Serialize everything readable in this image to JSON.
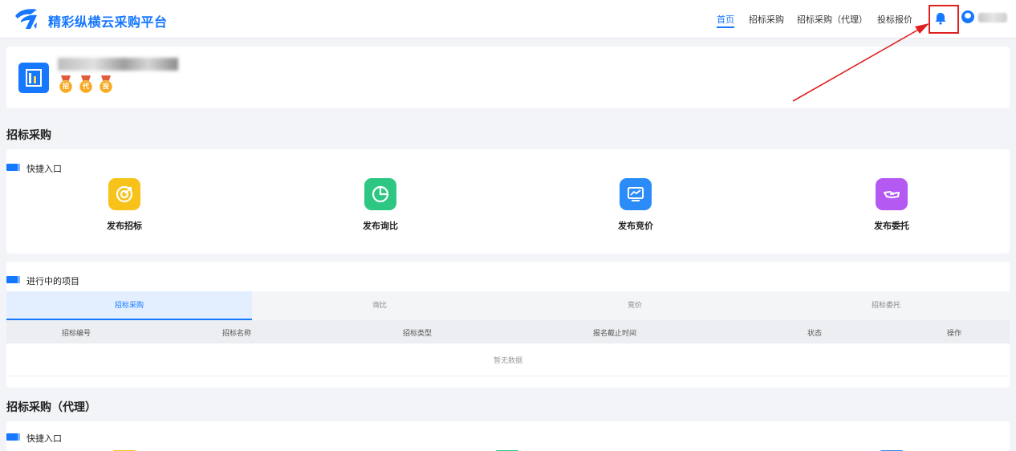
{
  "header": {
    "brand": "精彩纵横云采购平台",
    "nav": [
      {
        "label": "首页",
        "active": true
      },
      {
        "label": "招标采购",
        "active": false
      },
      {
        "label": "招标采购（代理）",
        "active": false
      },
      {
        "label": "投标报价",
        "active": false
      }
    ],
    "icons": [
      "logo-icon",
      "bell-icon",
      "user-avatar-icon"
    ],
    "accent_color": "#1677ff"
  },
  "profile": {
    "medals": [
      "招",
      "代",
      "投"
    ]
  },
  "section_bidding": {
    "title": "招标采购",
    "quick_entry_title": "快捷入口",
    "quick_items": [
      {
        "label": "发布招标",
        "icon": "target-icon",
        "color": "#f7c31b"
      },
      {
        "label": "发布询比",
        "icon": "pie-chart-icon",
        "color": "#2ec683"
      },
      {
        "label": "发布竞价",
        "icon": "monitor-chart-icon",
        "color": "#2b8cf7"
      },
      {
        "label": "发布委托",
        "icon": "handshake-icon",
        "color": "#b459f2"
      }
    ],
    "projects_title": "进行中的项目",
    "tabs": [
      {
        "label": "招标采购",
        "active": true
      },
      {
        "label": "询比",
        "active": false
      },
      {
        "label": "竞价",
        "active": false
      },
      {
        "label": "招标委托",
        "active": false
      }
    ],
    "table_headers": [
      "招标编号",
      "招标名称",
      "招标类型",
      "报名截止时间",
      "状态",
      "操作"
    ],
    "empty_text": "暂无数据"
  },
  "section_agent": {
    "title": "招标采购（代理）",
    "quick_entry_title": "快捷入口"
  },
  "annotation_color": "#e02020"
}
